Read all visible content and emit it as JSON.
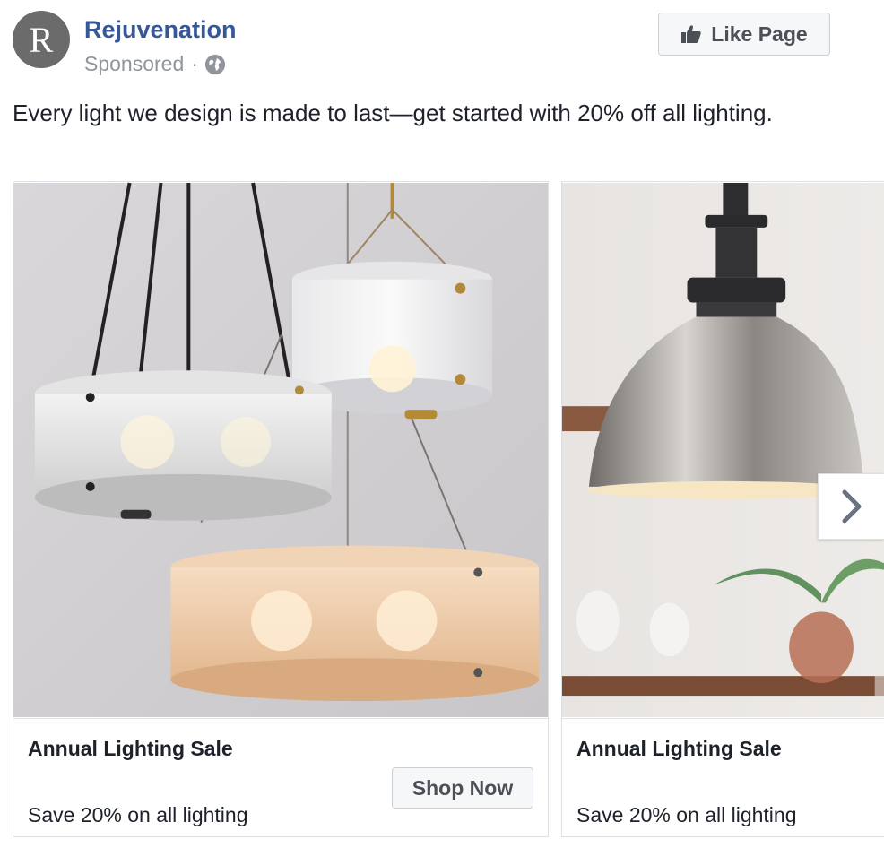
{
  "post": {
    "page_name": "Rejuvenation",
    "avatar_letter": "R",
    "sponsored_label": "Sponsored",
    "separator": "·",
    "like_button_label": "Like Page",
    "caption": "Every light we design is made to last—get started with 20% off all lighting."
  },
  "carousel": {
    "cards": [
      {
        "title": "Annual Lighting Sale",
        "description": "Save 20% on all lighting",
        "cta": "Shop Now"
      },
      {
        "title": "Annual Lighting Sale",
        "description": "Save 20% on all lighting"
      }
    ]
  },
  "colors": {
    "page_name": "#365899",
    "muted_text": "#90949c",
    "body_text": "#1d2129",
    "button_bg": "#f6f7f9",
    "border": "#dddfe2"
  },
  "icons": [
    "globe-icon",
    "thumbs-up-icon",
    "chevron-right-icon"
  ]
}
